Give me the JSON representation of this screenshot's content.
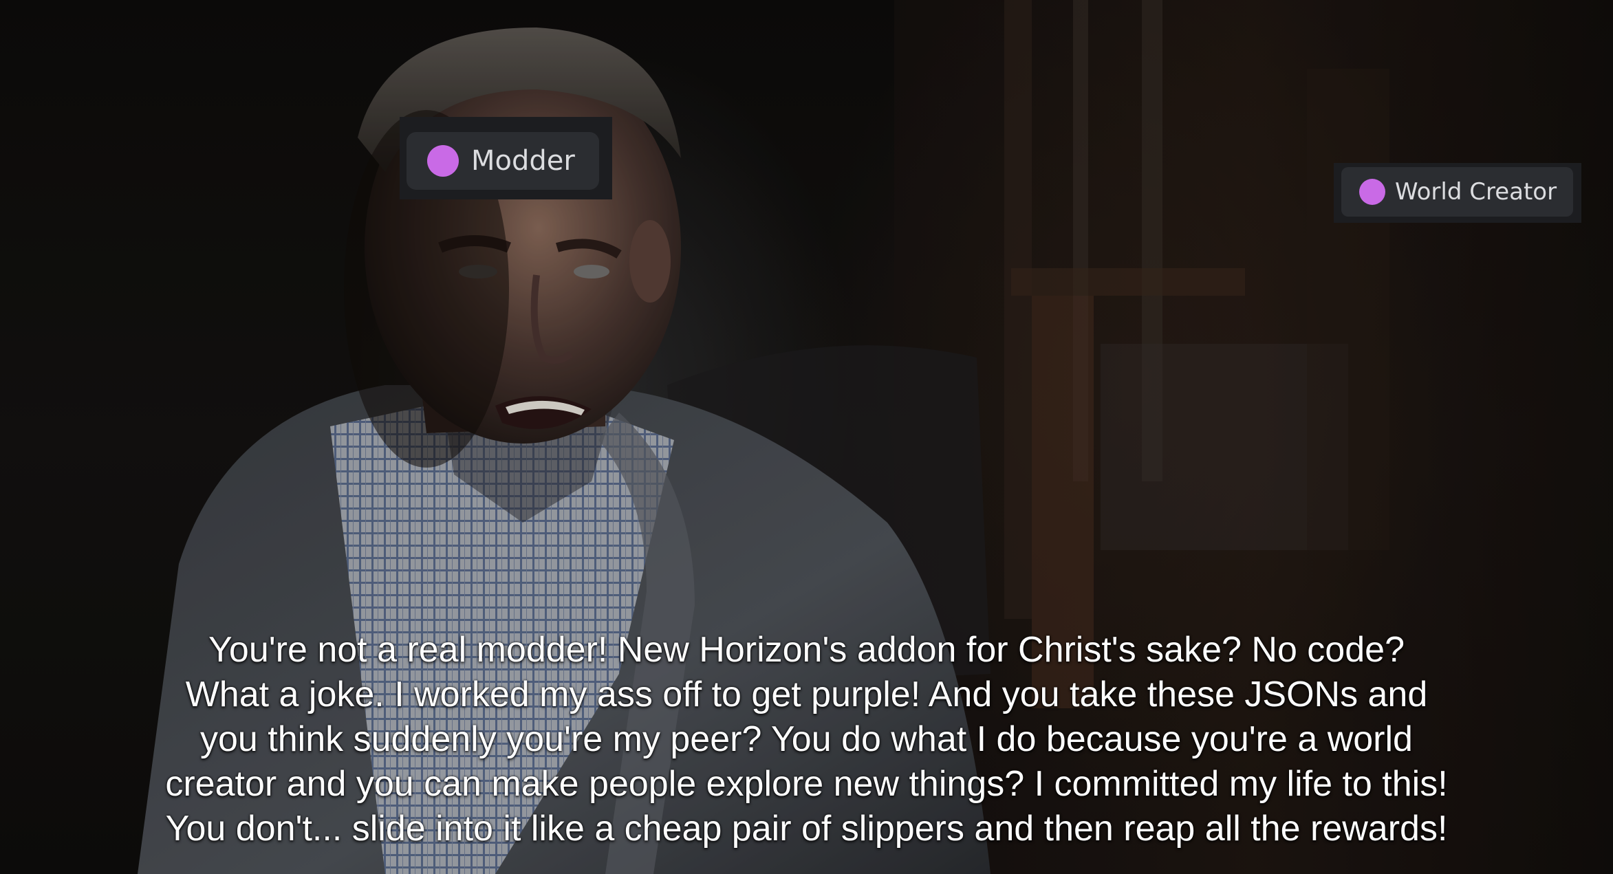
{
  "tags": {
    "modder": {
      "label": "Modder",
      "color": "#c96ae6"
    },
    "world_creator": {
      "label": "World Creator",
      "color": "#c96ae6"
    }
  },
  "caption": {
    "lines": [
      "You're not a real modder! New Horizon's addon for Christ's sake? No code?",
      "What a joke. I worked my ass off to get purple! And you take these JSONs and",
      "you think suddenly you're my peer? You do what I do because you're a world",
      "creator and you can make people explore new things? I committed my life to this!",
      "You don't... slide into it like a cheap pair of slippers and then reap all the rewards!"
    ]
  }
}
